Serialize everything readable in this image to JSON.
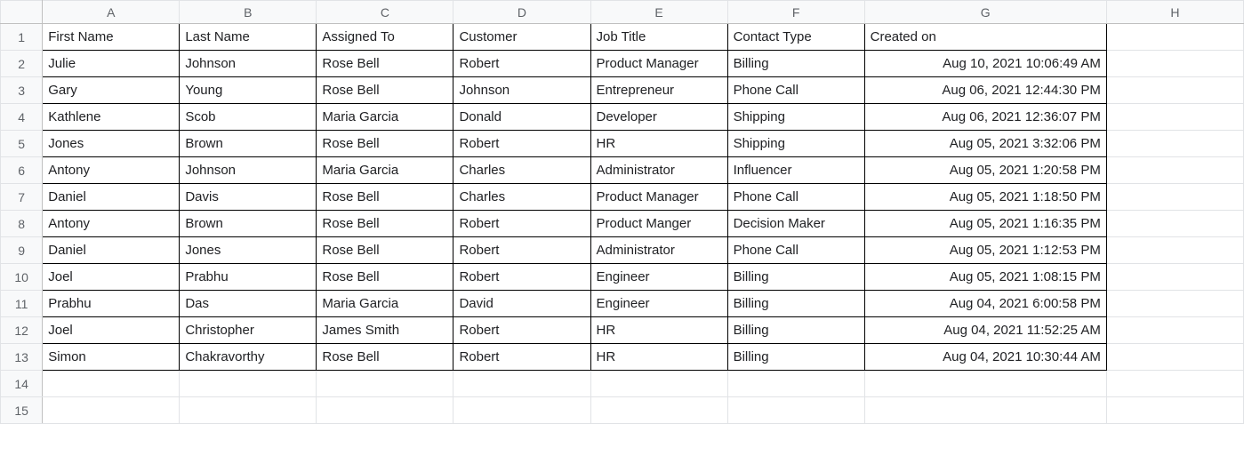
{
  "columns": [
    "A",
    "B",
    "C",
    "D",
    "E",
    "F",
    "G",
    "H"
  ],
  "row_count": 15,
  "headers": {
    "A": "First Name",
    "B": "Last Name",
    "C": "Assigned To",
    "D": "Customer",
    "E": "Job Title",
    "F": "Contact Type",
    "G": "Created on"
  },
  "rows": [
    {
      "A": "Julie",
      "B": "Johnson",
      "C": "Rose Bell",
      "D": "Robert",
      "E": "Product Manager",
      "F": "Billing",
      "G": "Aug 10, 2021 10:06:49 AM"
    },
    {
      "A": "Gary",
      "B": "Young",
      "C": "Rose Bell",
      "D": "Johnson",
      "E": "Entrepreneur",
      "F": "Phone Call",
      "G": "Aug 06, 2021 12:44:30 PM"
    },
    {
      "A": "Kathlene",
      "B": "Scob",
      "C": "Maria Garcia",
      "D": "Donald",
      "E": "Developer",
      "F": "Shipping",
      "G": "Aug 06, 2021 12:36:07 PM"
    },
    {
      "A": "Jones",
      "B": "Brown",
      "C": "Rose Bell",
      "D": "Robert",
      "E": "HR",
      "F": "Shipping",
      "G": "Aug 05, 2021 3:32:06 PM"
    },
    {
      "A": "Antony",
      "B": "Johnson",
      "C": "Maria Garcia",
      "D": "Charles",
      "E": "Administrator",
      "F": "Influencer",
      "G": "Aug 05, 2021 1:20:58 PM"
    },
    {
      "A": "Daniel",
      "B": "Davis",
      "C": "Rose Bell",
      "D": "Charles",
      "E": "Product Manager",
      "F": "Phone Call",
      "G": "Aug 05, 2021 1:18:50 PM"
    },
    {
      "A": "Antony",
      "B": "Brown",
      "C": "Rose Bell",
      "D": "Robert",
      "E": "Product Manger",
      "F": "Decision Maker",
      "G": "Aug 05, 2021 1:16:35 PM"
    },
    {
      "A": "Daniel",
      "B": "Jones",
      "C": "Rose Bell",
      "D": "Robert",
      "E": "Administrator",
      "F": "Phone Call",
      "G": "Aug 05, 2021 1:12:53 PM"
    },
    {
      "A": "Joel",
      "B": "Prabhu",
      "C": "Rose Bell",
      "D": "Robert",
      "E": "Engineer",
      "F": "Billing",
      "G": "Aug 05, 2021 1:08:15 PM"
    },
    {
      "A": "Prabhu",
      "B": "Das",
      "C": "Maria Garcia",
      "D": "David",
      "E": "Engineer",
      "F": "Billing",
      "G": "Aug 04, 2021 6:00:58 PM"
    },
    {
      "A": "Joel",
      "B": "Christopher",
      "C": "James Smith",
      "D": "Robert",
      "E": "HR",
      "F": "Billing",
      "G": "Aug 04, 2021 11:52:25 AM"
    },
    {
      "A": "Simon",
      "B": "Chakravorthy",
      "C": "Rose Bell",
      "D": "Robert",
      "E": "HR",
      "F": "Billing",
      "G": "Aug 04, 2021 10:30:44 AM"
    }
  ]
}
